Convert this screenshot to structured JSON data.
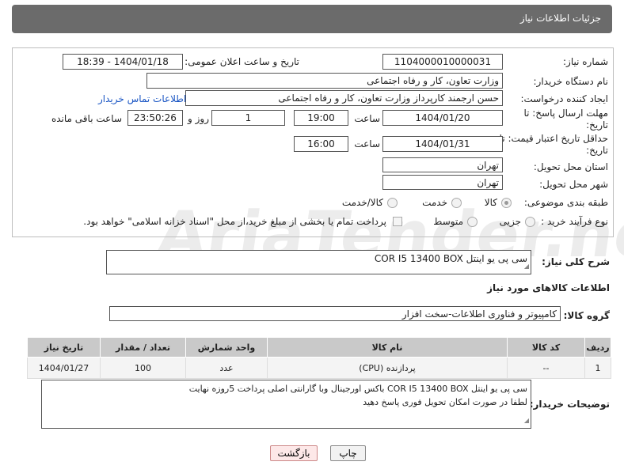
{
  "header": {
    "title": "جزئیات اطلاعات نیاز"
  },
  "labels": {
    "need_number": "شماره نیاز:",
    "announce_datetime": "تاریخ و ساعت اعلان عمومی:",
    "buyer_org": "نام دستگاه خریدار:",
    "requester": "ایجاد کننده درخواست:",
    "buyer_contact": "اطلاعات تماس خریدار",
    "reply_deadline": "مهلت ارسال پاسخ: تا تاریخ:",
    "time": "ساعت",
    "day_and": "روز و",
    "remaining": "ساعت باقی مانده",
    "price_validity": "حداقل تاریخ اعتبار قیمت: تا تاریخ:",
    "province": "استان محل تحویل:",
    "city": "شهر محل تحویل:",
    "category": "طبقه بندی موضوعی:",
    "purchase_type": "نوع فرآیند خرید :",
    "general_desc": "شرح کلی نیاز:",
    "goods_info": "اطلاعات کالاهای مورد نیاز",
    "goods_group": "گروه کالا:",
    "buyer_notes": "توضیحات خریدار:"
  },
  "fields": {
    "need_number": "1104000010000031",
    "announce_datetime": "1404/01/18 - 18:39",
    "buyer_org": "وزارت تعاون، کار و رفاه اجتماعی",
    "requester": "حسن ارجمند کارپرداز وزارت تعاون، کار و رفاه اجتماعی",
    "reply_date": "1404/01/20",
    "reply_time": "19:00",
    "remaining_days": "1",
    "remaining_time": "23:50:26",
    "validity_date": "1404/01/31",
    "validity_time": "16:00",
    "province": "تهران",
    "city": "تهران",
    "general_desc": "سی پی یو اینتل COR I5 13400 BOX",
    "goods_group": "کامپیوتر و فناوری اطلاعات-سخت افزار",
    "buyer_notes_line1": "سی پی یو اینتل COR I5 13400 BOX   باکس اورجینال وبا گارانتی اصلی   پرداخت 5روزه نهایت",
    "buyer_notes_line2": "لطفا در صورت امکان تحویل فوری پاسخ دهید"
  },
  "category_options": [
    {
      "label": "کالا",
      "selected": true
    },
    {
      "label": "خدمت",
      "selected": false
    },
    {
      "label": "کالا/خدمت",
      "selected": false
    }
  ],
  "purchase_options": [
    {
      "label": "جزیی",
      "selected": false
    },
    {
      "label": "متوسط",
      "selected": false
    }
  ],
  "payment_note": "پرداخت تمام یا بخشی از مبلغ خرید،از محل \"اسناد خزانه اسلامی\" خواهد بود.",
  "table": {
    "headers": [
      "ردیف",
      "کد کالا",
      "نام کالا",
      "واحد شمارش",
      "تعداد / مقدار",
      "تاریخ نیاز"
    ],
    "rows": [
      [
        "1",
        "--",
        "پردازنده (CPU)",
        "عدد",
        "100",
        "1404/01/27"
      ]
    ]
  },
  "buttons": {
    "print": "چاپ",
    "back": "بازگشت"
  },
  "watermark": "AriaTender.neT"
}
